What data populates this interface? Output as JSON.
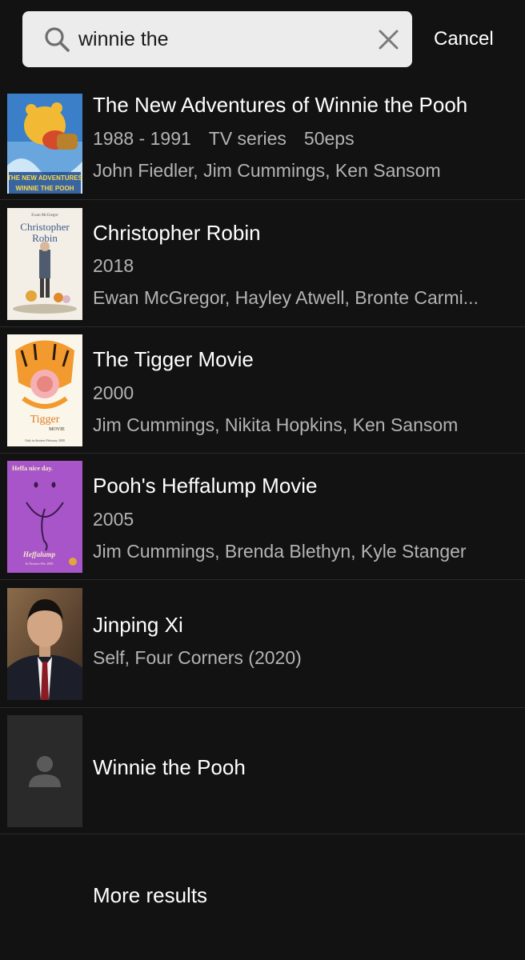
{
  "search": {
    "query": "winnie the",
    "cancel_label": "Cancel"
  },
  "results": [
    {
      "title": "The New Adventures of Winnie the Pooh",
      "years": "1988 - 1991",
      "kind": "TV series",
      "episodes": "50eps",
      "cast": "John Fiedler, Jim Cummings, Ken Sansom",
      "poster_text": "THE NEW ADVENTURES OF WINNIE THE POOH"
    },
    {
      "title": "Christopher Robin",
      "year": "2018",
      "cast": "Ewan McGregor, Hayley Atwell, Bronte Carmi...",
      "poster_text": "Christopher Robin"
    },
    {
      "title": "The Tigger Movie",
      "year": "2000",
      "cast": "Jim Cummings, Nikita Hopkins, Ken Sansom",
      "poster_text": "The Tigger Movie"
    },
    {
      "title": "Pooh's Heffalump Movie",
      "year": "2005",
      "cast": "Jim Cummings, Brenda Blethyn, Kyle Stanger",
      "poster_text": "Heffa nice day. Heffalump"
    },
    {
      "title": "Jinping Xi",
      "credit": "Self, Four Corners (2020)"
    },
    {
      "title": "Winnie the Pooh",
      "placeholder_icon": "person-icon"
    }
  ],
  "more_results_label": "More results",
  "colors": {
    "background": "#121212",
    "search_field": "#ececec",
    "secondary_text": "#b3b3b3",
    "heffalump_poster": "#a855c9"
  }
}
